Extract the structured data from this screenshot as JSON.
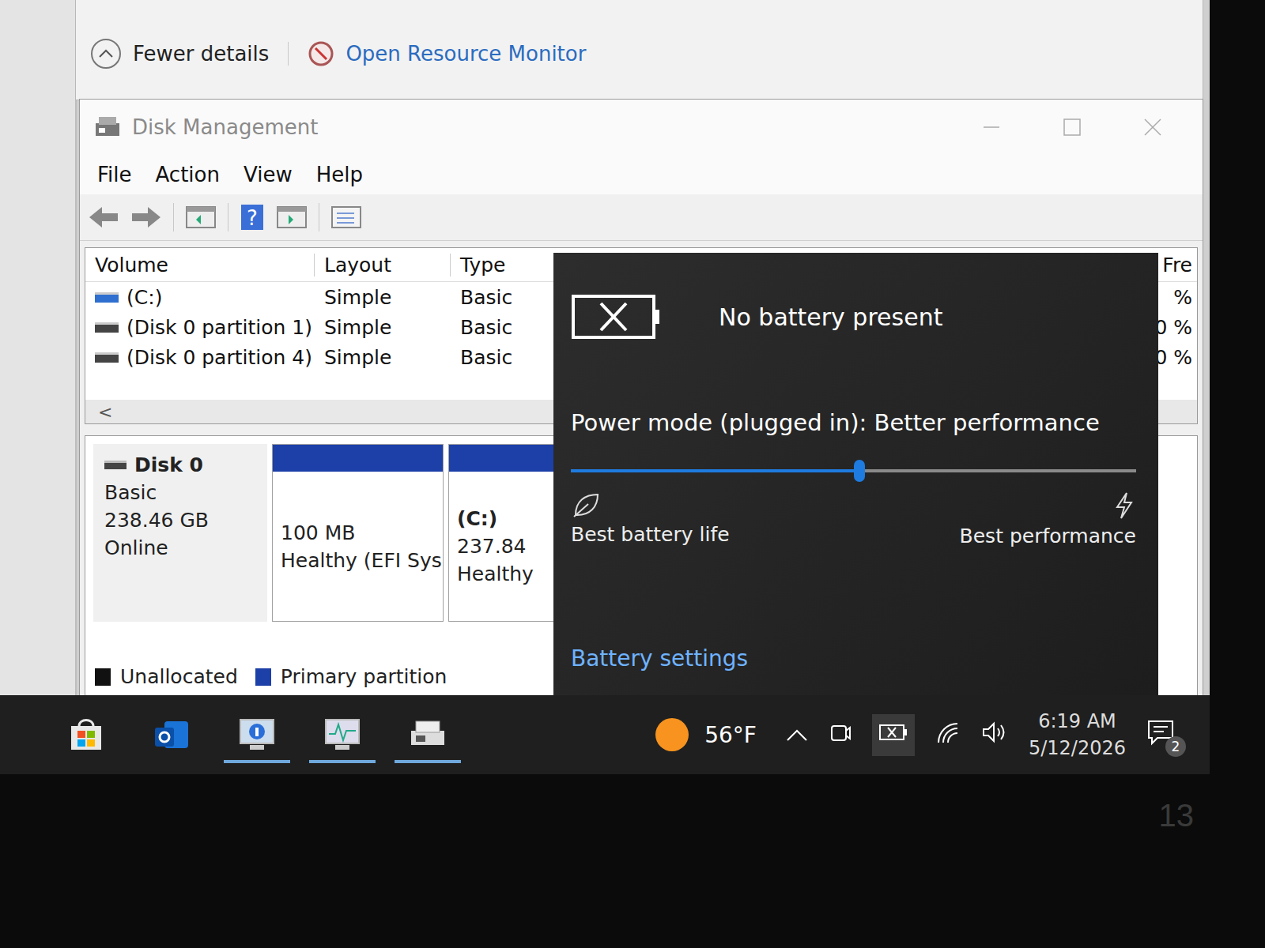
{
  "task_manager": {
    "fewer_details": "Fewer details",
    "resource_monitor": "Open Resource Monitor"
  },
  "disk_management": {
    "title": "Disk Management",
    "menu": [
      "File",
      "Action",
      "View",
      "Help"
    ],
    "table": {
      "columns": [
        "Volume",
        "Layout",
        "Type",
        "Fre"
      ],
      "rows": [
        {
          "cells": [
            "(C:)",
            "Simple",
            "Basic",
            "%"
          ],
          "color": "#2f6fcf"
        },
        {
          "cells": [
            "(Disk 0 partition 1)",
            "Simple",
            "Basic",
            "0 %"
          ],
          "color": "#444444"
        },
        {
          "cells": [
            "(Disk 0 partition 4)",
            "Simple",
            "Basic",
            "0 %"
          ],
          "color": "#444444"
        }
      ]
    },
    "scroll_arrow": "<",
    "disk": {
      "name": "Disk 0",
      "type": "Basic",
      "size": "238.46 GB",
      "status": "Online",
      "partitions": [
        {
          "size": "100 MB",
          "status": "Healthy (EFI Sys"
        },
        {
          "label": "(C:)",
          "size": "237.84",
          "status": "Healthy"
        }
      ]
    },
    "legend": [
      {
        "label": "Unallocated",
        "color": "#111111"
      },
      {
        "label": "Primary partition",
        "color": "#1c3fa8"
      }
    ]
  },
  "battery_flyout": {
    "status": "No battery present",
    "power_mode": "Power mode (plugged in): Better performance",
    "slider": {
      "level": 0.51
    },
    "left_label": "Best battery life",
    "right_label": "Best performance",
    "link": "Battery settings"
  },
  "taskbar": {
    "apps": [
      {
        "kind": "store",
        "active": false
      },
      {
        "kind": "outlook",
        "active": false
      },
      {
        "kind": "sysinfo",
        "active": true
      },
      {
        "kind": "perfmon",
        "active": true
      },
      {
        "kind": "diskmgmt",
        "active": true
      }
    ],
    "weather": "56°F",
    "time": "6:19 AM",
    "date": "5/12/2026",
    "notifications": "2"
  },
  "bezel": {
    "label": "13"
  }
}
